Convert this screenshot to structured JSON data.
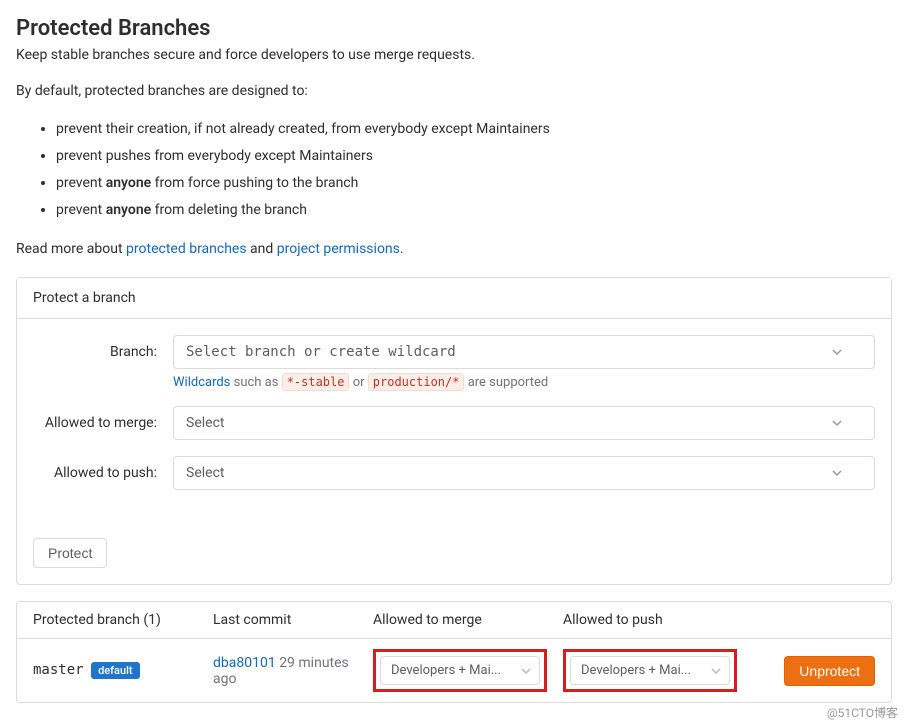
{
  "header": {
    "title": "Protected Branches",
    "subtitle": "Keep stable branches secure and force developers to use merge requests.",
    "designIntro": "By default, protected branches are designed to:",
    "bullets": {
      "b1_pre": "prevent their creation, if not already created, from everybody except Maintainers",
      "b2_pre": "prevent pushes from everybody except Maintainers",
      "b3_pre": "prevent ",
      "b3_strong": "anyone",
      "b3_post": " from force pushing to the branch",
      "b4_pre": "prevent ",
      "b4_strong": "anyone",
      "b4_post": " from deleting the branch"
    },
    "readMorePre": "Read more about ",
    "readMoreLink1": "protected branches",
    "readMoreMid": " and ",
    "readMoreLink2": "project permissions",
    "readMorePost": "."
  },
  "form": {
    "panelTitle": "Protect a branch",
    "branchLabel": "Branch:",
    "branchPlaceholder": "Select branch or create wildcard",
    "wildcardHintLink": "Wildcards",
    "wildcardHint1": " such as ",
    "wildcardCode1": "*-stable",
    "wildcardHint2": " or ",
    "wildcardCode2": "production/*",
    "wildcardHint3": " are supported",
    "mergeLabel": "Allowed to merge:",
    "mergePlaceholder": "Select",
    "pushLabel": "Allowed to push:",
    "pushPlaceholder": "Select",
    "protectBtn": "Protect"
  },
  "table": {
    "headers": {
      "branch": "Protected branch (1)",
      "commit": "Last commit",
      "merge": "Allowed to merge",
      "push": "Allowed to push"
    },
    "row": {
      "branchName": "master",
      "badge": "default",
      "commitHash": "dba80101",
      "commitTime": " 29 minutes ago",
      "mergeValue": "Developers + Mai...",
      "pushValue": "Developers + Mai...",
      "unprotectBtn": "Unprotect"
    }
  },
  "watermark": "@51CTO博客"
}
